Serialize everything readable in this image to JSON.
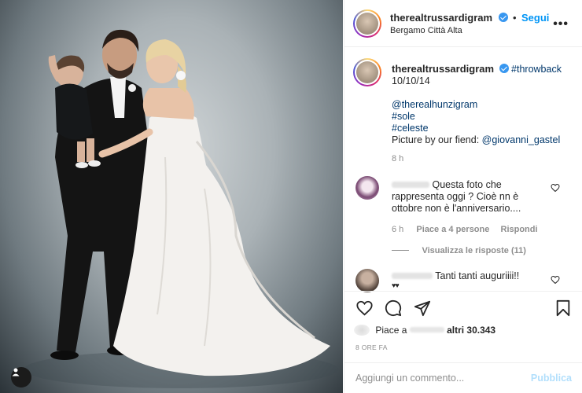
{
  "post_header": {
    "username": "therealtrussardigram",
    "follow_label": "Segui",
    "location": "Bergamo Città Alta",
    "more_icon": "more-horizontal-icon"
  },
  "caption": {
    "username": "therealtrussardigram",
    "hashtag": "#throwback",
    "date": "10/10/14",
    "mention": "@therealhunzigram",
    "tag_sole": "#sole",
    "tag_celeste": "#celeste",
    "credit_prefix": "Picture by our fiend: ",
    "credit_mention": "@giovanni_gastel",
    "time": "8 h"
  },
  "comments": [
    {
      "text_line1": "Questa foto che",
      "text_line2": "rappresenta oggi ? Cioè nn è",
      "text_line3": "ottobre non è l'anniversario....",
      "time": "6 h",
      "likes": "Piace a 4 persone",
      "reply": "Rispondi",
      "view_replies": "Visualizza le risposte (11)"
    },
    {
      "text": "Tanti tanti auguriiii!!"
    }
  ],
  "actions": {
    "likes_prefix": "Piace a",
    "likes_suffix": "altri 30.343",
    "time_ago": "8 ORE FA"
  },
  "add_comment": {
    "placeholder": "Aggiungi un commento...",
    "post_label": "Pubblica"
  },
  "colors": {
    "accent": "#0095f6",
    "text": "#262626",
    "muted": "#8e8e8e"
  }
}
